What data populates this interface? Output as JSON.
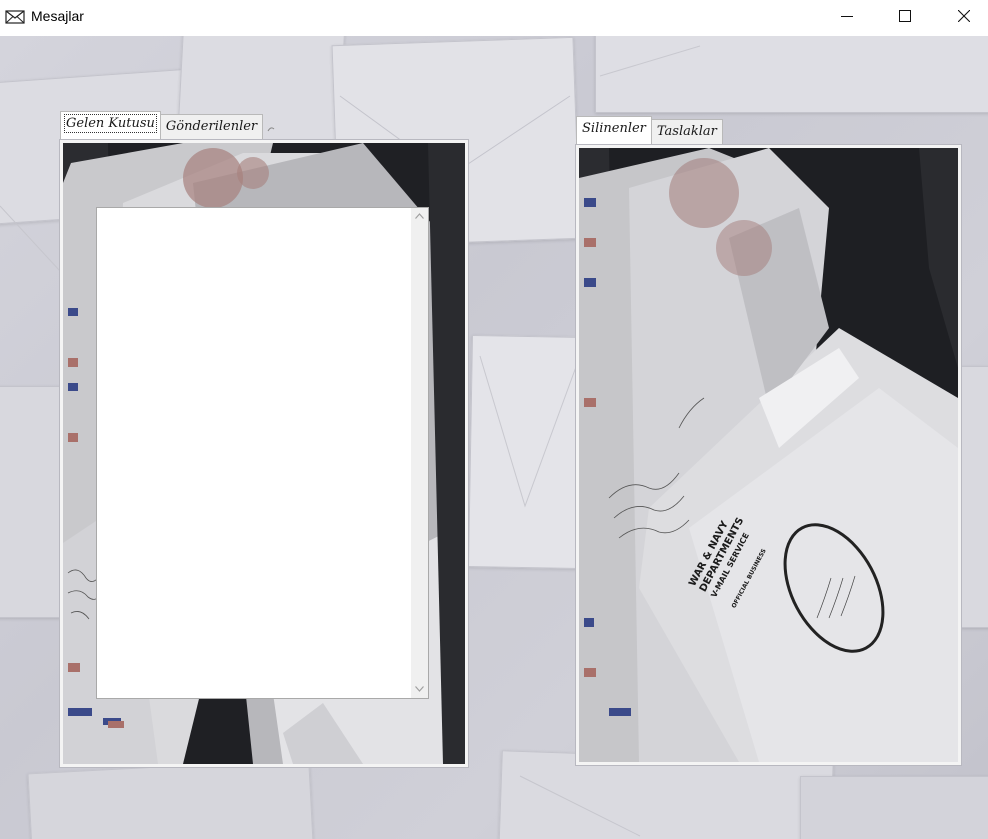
{
  "window": {
    "title": "Mesajlar",
    "app_icon": "envelope-icon",
    "controls": [
      "minimize-icon",
      "maximize-icon",
      "close-icon"
    ]
  },
  "left_panel": {
    "tabs": [
      {
        "label": "Gelen Kutusu",
        "active": true
      },
      {
        "label": "Gönderilenler",
        "active": false
      }
    ],
    "list_items": []
  },
  "right_panel": {
    "tabs": [
      {
        "label": "Silinenler",
        "active": true
      },
      {
        "label": "Taslaklar",
        "active": false
      }
    ]
  },
  "photo": {
    "stamp_lines": [
      "WAR & NAVY",
      "DEPARTMENTS",
      "V-MAIL SERVICE",
      "OFFICIAL BUSINESS"
    ]
  },
  "colors": {
    "background": "#d0d0d8",
    "tab_active": "#ffffff",
    "tab_inactive": "#f0f0f0",
    "panel_dark": "#232428"
  }
}
